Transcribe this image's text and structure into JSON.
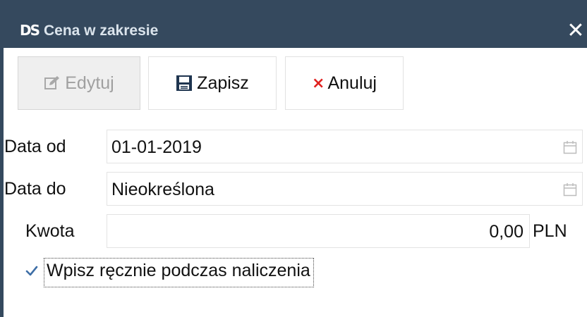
{
  "window": {
    "logo": "DS",
    "title": "Cena w zakresie",
    "close_symbol": "✕"
  },
  "toolbar": {
    "edit_label": "Edytuj",
    "save_label": "Zapisz",
    "cancel_label": "Anuluj",
    "cancel_symbol": "×"
  },
  "form": {
    "date_from_label": "Data od",
    "date_from_value": "01-01-2019",
    "date_to_label": "Data do",
    "date_to_value": "Nieokreślona",
    "amount_label": "Kwota",
    "amount_value": "0,00",
    "currency": "PLN",
    "manual_entry_label": "Wpisz ręcznie podczas naliczenia",
    "manual_entry_checked": true
  },
  "colors": {
    "title_bar": "#35495e",
    "cancel_icon": "#e0201e"
  }
}
